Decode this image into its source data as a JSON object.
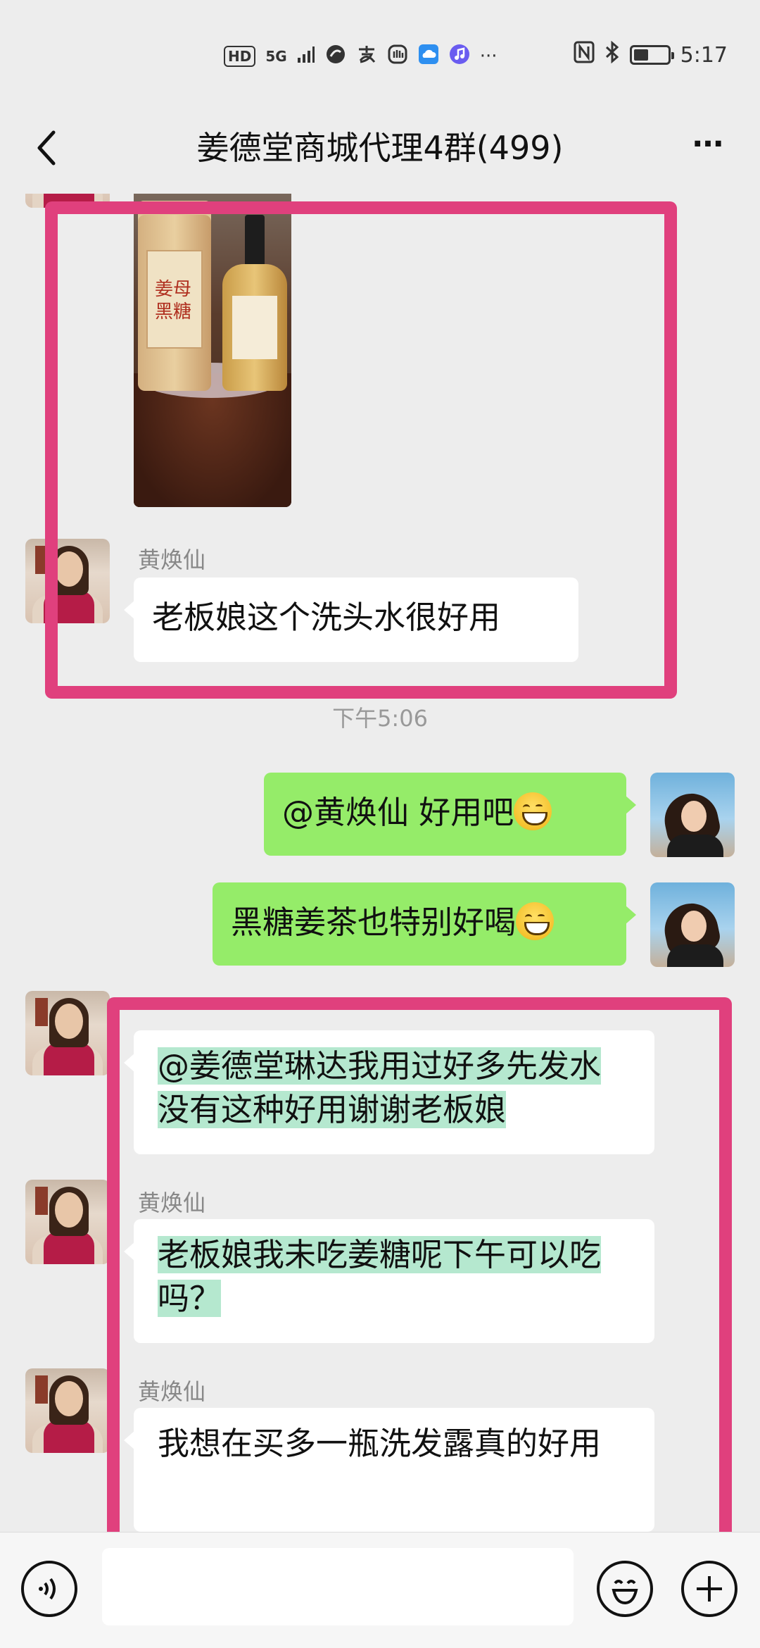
{
  "status_bar": {
    "left_icons": [
      "HD",
      "5G",
      "signal-icon",
      "app-icon",
      "alipay-icon",
      "hand-icon",
      "cloud-icon",
      "music-icon"
    ],
    "hd": "HD",
    "network": "5G",
    "ellipsis": "···",
    "time": "5:17",
    "battery_level": 0.45
  },
  "header": {
    "back_icon": "chevron-left-icon",
    "title": "姜德堂商城代理4群(499)",
    "more_icon": "more-dots-icon",
    "more_label": "···"
  },
  "messages": {
    "m1": {
      "sender": "黄焕仙",
      "text": "老板娘这个洗头水很好用"
    },
    "timestamp": "下午5:06",
    "m2": {
      "text": "@黄焕仙  好用吧"
    },
    "m3": {
      "text": "黑糖姜茶也特别好喝"
    },
    "m4": {
      "text": "@姜德堂琳达我用过好多先发水没有这种好用谢谢老板娘"
    },
    "m5": {
      "sender": "黄焕仙",
      "text": "老板娘我未吃姜糖呢下午可以吃吗？"
    },
    "m6": {
      "sender": "黄焕仙",
      "text": "我想在买多一瓶洗发露真的好用"
    }
  },
  "photo": {
    "jar_text": "姜母黑糖"
  },
  "input_bar": {
    "voice_icon": "voice-icon",
    "emoji_icon": "emoji-icon",
    "plus_icon": "plus-icon"
  },
  "colors": {
    "background": "#ededed",
    "bubble_out": "#95ec69",
    "bubble_in": "#ffffff",
    "highlight": "#b5e8cf",
    "annotation": "#e0407d"
  }
}
